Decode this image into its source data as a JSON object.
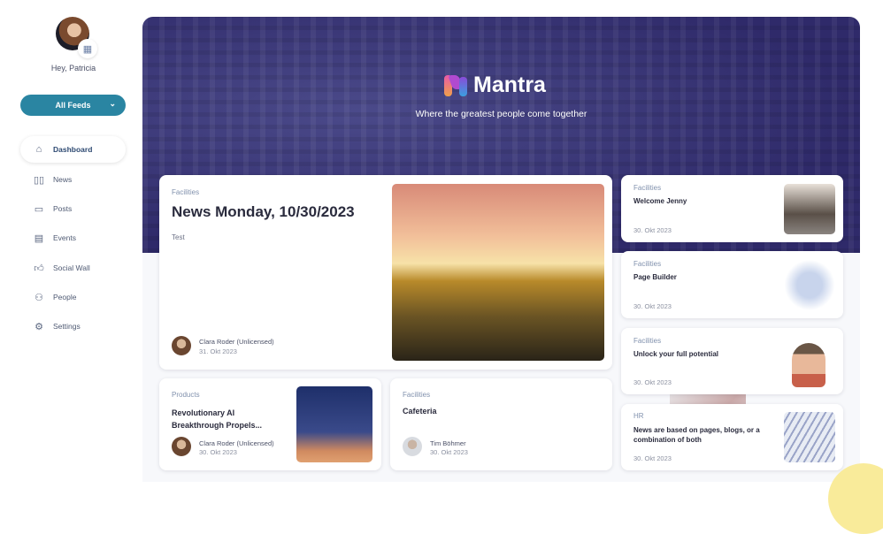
{
  "user": {
    "greeting": "Hey, Patricia"
  },
  "feeds": {
    "label": "All Feeds"
  },
  "nav": [
    {
      "label": "Dashboard",
      "icon": "home-icon"
    },
    {
      "label": "News",
      "icon": "book-icon"
    },
    {
      "label": "Posts",
      "icon": "chat-icon"
    },
    {
      "label": "Events",
      "icon": "calendar-icon"
    },
    {
      "label": "Social Wall",
      "icon": "thumbs-up-icon"
    },
    {
      "label": "People",
      "icon": "people-icon"
    },
    {
      "label": "Settings",
      "icon": "gear-icon"
    }
  ],
  "banner": {
    "brand": "Mantra",
    "tagline": "Where the greatest people come together"
  },
  "featured": {
    "category": "Facilities",
    "title": "News Monday, 10/30/2023",
    "excerpt": "Test",
    "author": "Clara Roder (Unlicensed)",
    "date": "31. Okt 2023"
  },
  "cards": [
    {
      "category": "Products",
      "title": "Revolutionary AI Breakthrough Propels...",
      "author": "Clara Roder (Unlicensed)",
      "date": "30. Okt 2023"
    },
    {
      "category": "Facilities",
      "title": "Cafeteria",
      "author": "Tim Böhmer",
      "date": "30. Okt 2023"
    }
  ],
  "side_cards": [
    {
      "category": "Facilities",
      "title": "Welcome Jenny",
      "date": "30. Okt 2023"
    },
    {
      "category": "Facilities",
      "title": "Page Builder",
      "date": "30. Okt 2023"
    },
    {
      "category": "Facilities",
      "title": "Unlock your full potential",
      "date": "30. Okt 2023"
    },
    {
      "category": "HR",
      "title": "News are based on pages, blogs, or a combination of both",
      "date": "30. Okt 2023"
    }
  ],
  "colors": {
    "accent": "#2a85a2",
    "banner": "#34306e"
  }
}
